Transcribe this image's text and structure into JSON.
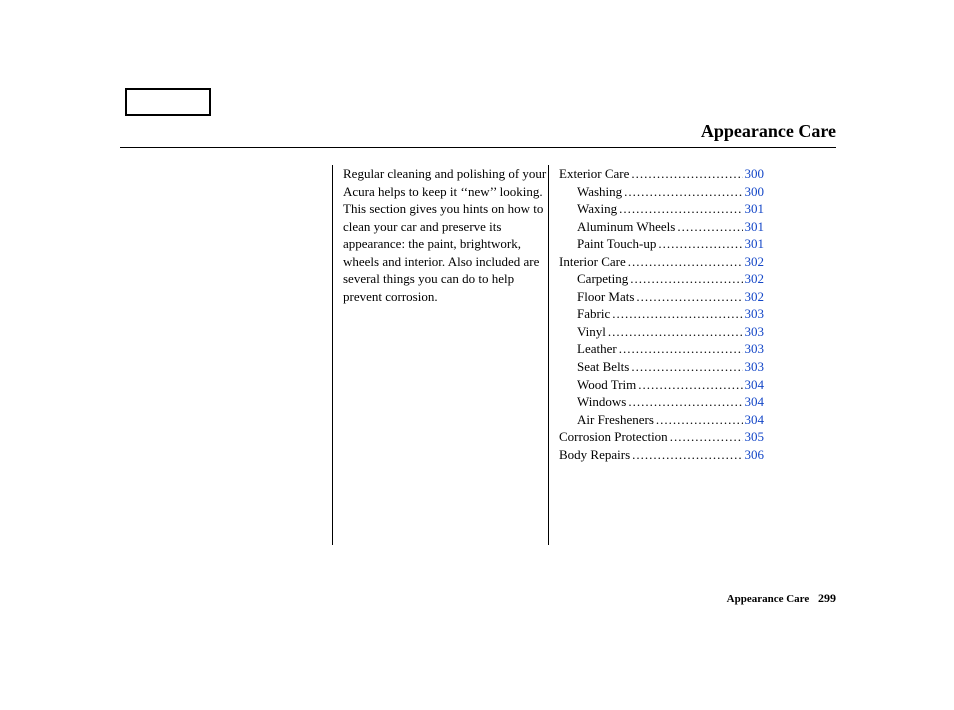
{
  "heading": "Appearance Care",
  "intro_text": "Regular cleaning and polishing of your Acura helps to keep it ‘‘new’’ looking. This section gives you hints on how to clean your car and preserve its appearance: the paint, brightwork, wheels and interior. Also included are several things you can do to help prevent corrosion.",
  "toc": [
    {
      "label": "Exterior Care",
      "page": "300",
      "indent": false
    },
    {
      "label": "Washing",
      "page": "300",
      "indent": true
    },
    {
      "label": "Waxing",
      "page": "301",
      "indent": true
    },
    {
      "label": "Aluminum Wheels",
      "page": "301",
      "indent": true
    },
    {
      "label": "Paint Touch-up",
      "page": "301",
      "indent": true
    },
    {
      "label": "Interior Care",
      "page": "302",
      "indent": false
    },
    {
      "label": "Carpeting",
      "page": "302",
      "indent": true
    },
    {
      "label": "Floor Mats",
      "page": "302",
      "indent": true
    },
    {
      "label": "Fabric",
      "page": "303",
      "indent": true
    },
    {
      "label": "Vinyl",
      "page": "303",
      "indent": true
    },
    {
      "label": "Leather",
      "page": "303",
      "indent": true
    },
    {
      "label": "Seat Belts",
      "page": "303",
      "indent": true
    },
    {
      "label": "Wood Trim",
      "page": "304",
      "indent": true
    },
    {
      "label": "Windows",
      "page": "304",
      "indent": true
    },
    {
      "label": "Air Fresheners",
      "page": "304",
      "indent": true
    },
    {
      "label": "Corrosion Protection",
      "page": "305",
      "indent": false
    },
    {
      "label": "Body Repairs",
      "page": "306",
      "indent": false
    }
  ],
  "footer": {
    "section_label": "Appearance Care",
    "page_number": "299"
  }
}
